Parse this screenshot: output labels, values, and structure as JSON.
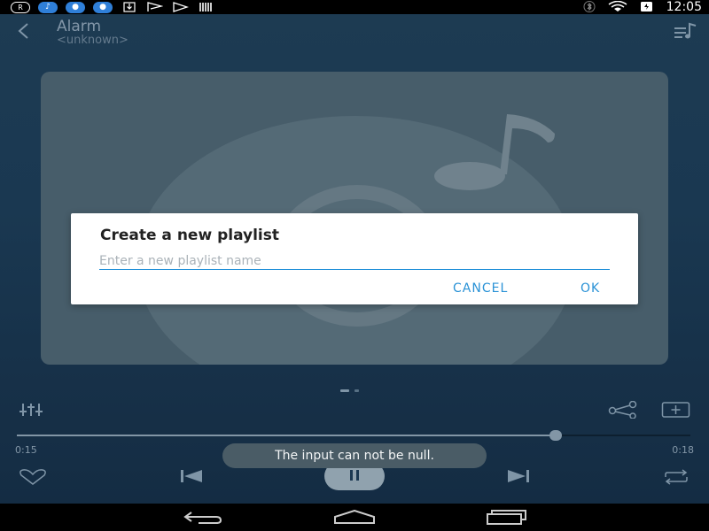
{
  "status_bar": {
    "time": "12:05",
    "left_icons": [
      "r-circle-icon",
      "music-note-icon",
      "water-drop-icon",
      "water-drop-icon",
      "download-icon",
      "flag-icon",
      "play-flag-icon",
      "barcode-icon"
    ],
    "right_icons": [
      "bluetooth-icon",
      "wifi-icon",
      "battery-icon"
    ]
  },
  "header": {
    "title": "Alarm",
    "subtitle": "<unknown>"
  },
  "player": {
    "current_time": "0:15",
    "total_time": "0:18",
    "progress": 0.8
  },
  "dialog": {
    "title": "Create a new playlist",
    "input_value": "",
    "input_placeholder": "Enter a new playlist name",
    "cancel_label": "CANCEL",
    "ok_label": "OK"
  },
  "toast": {
    "message": "The input can not be null."
  },
  "colors": {
    "accent": "#2a92d6",
    "background_top": "#20405a",
    "background_bottom": "#163049"
  }
}
